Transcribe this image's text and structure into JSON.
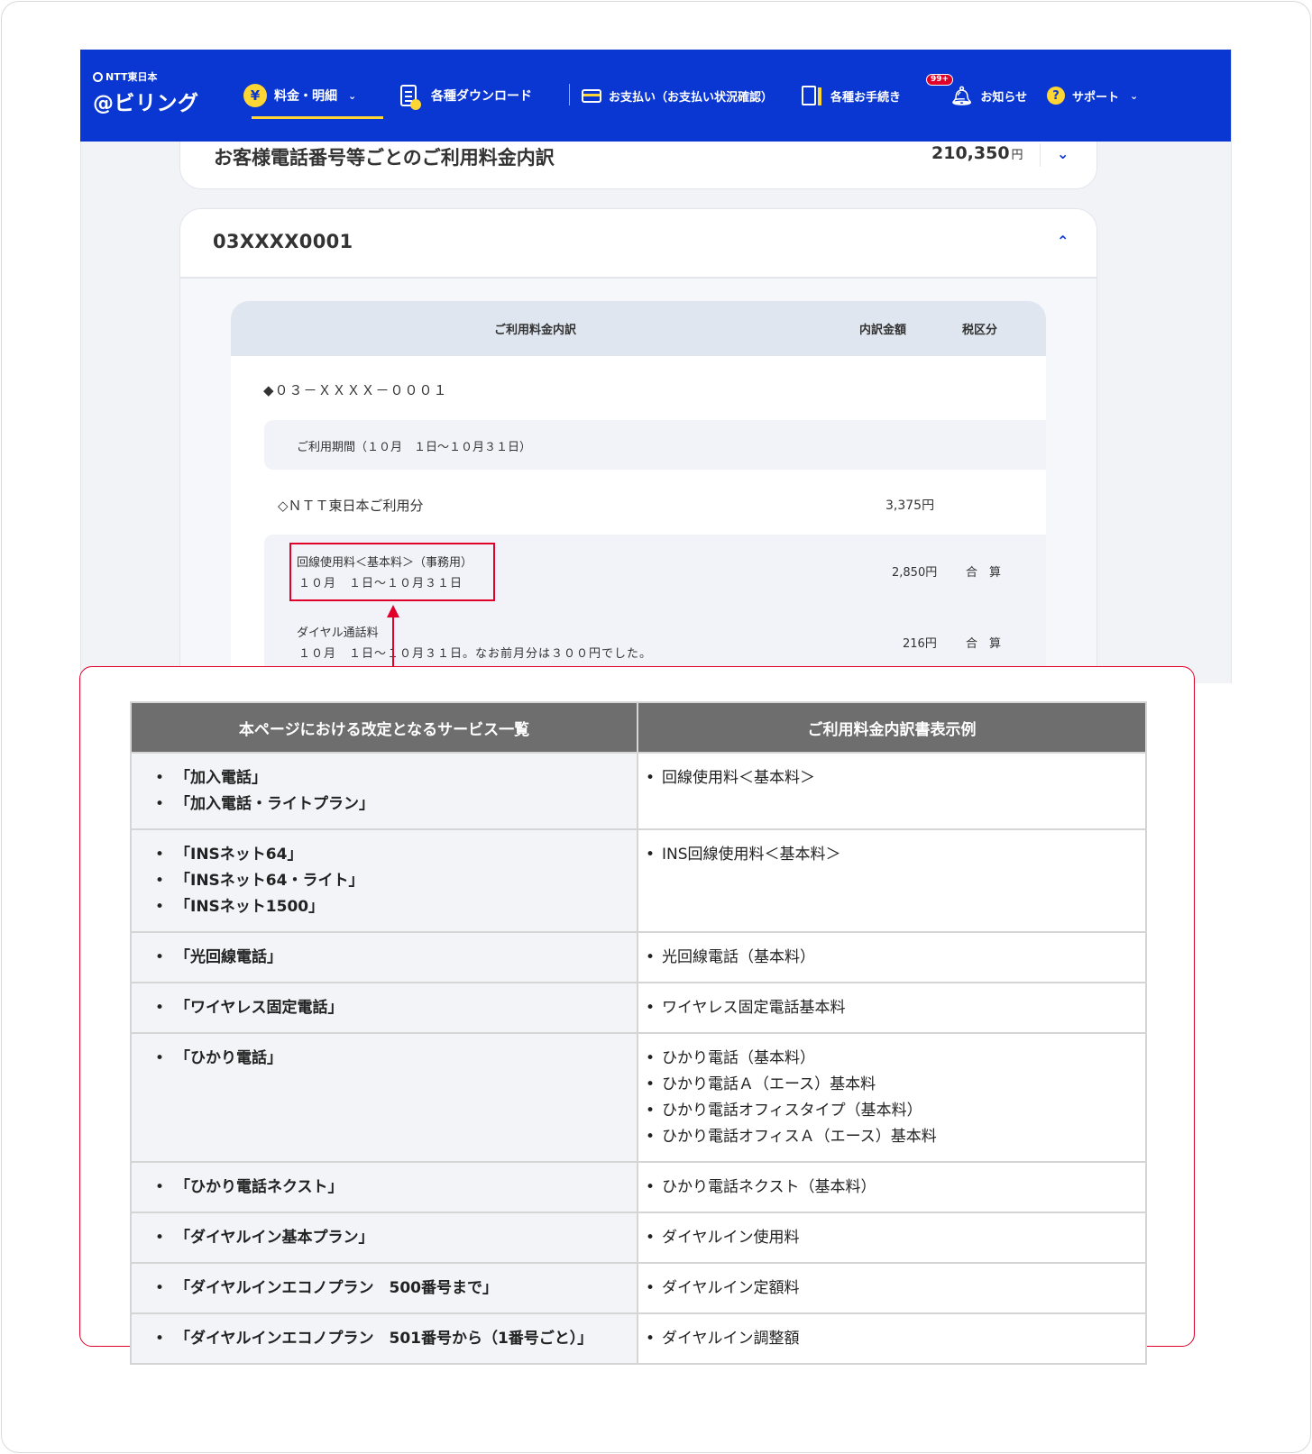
{
  "navbar": {
    "logo_small": "NTT東日本",
    "logo_main": "@ビリング",
    "items": [
      {
        "label": "料金・明細",
        "icon": "yen-icon"
      },
      {
        "label": "各種ダウンロード",
        "icon": "document-download-icon"
      },
      {
        "label": "お支払い（お支払い状況確認）",
        "icon": "credit-card-icon"
      },
      {
        "label": "各種お手続き",
        "icon": "form-icon"
      },
      {
        "label": "お知らせ",
        "icon": "bell-icon",
        "badge": "99+"
      },
      {
        "label": "サポート",
        "icon": "support-icon"
      }
    ],
    "yen_glyph": "¥",
    "support_glyph": "?",
    "colors": {
      "bar": "#0a37d2",
      "accent": "#ffd633",
      "badge": "#e0002a"
    }
  },
  "summary_card": {
    "title": "お客様電話番号等ごとのご利用料金内訳",
    "amount": "210,350",
    "unit": "円"
  },
  "number_card": {
    "title": "03XXXX0001"
  },
  "detail_table": {
    "headers": [
      "ご利用料金内訳",
      "内訳金額",
      "税区分"
    ],
    "phone_heading": "◆０３－ＸＸＸＸ－０００１",
    "period": "ご利用期間（１０月　１日～１０月３１日）",
    "section": {
      "label": "◇ＮＴＴ東日本ご利用分",
      "amount": "3,375円"
    },
    "rows": [
      {
        "line1": "回線使用料＜基本料＞（事務用）",
        "line2": "１０月　１日～１０月３１日",
        "amount": "2,850円",
        "tax": "合　算"
      },
      {
        "line1": "ダイヤル通話料",
        "line2": "１０月　１日～１０月３１日。なお前月分は３００円でした。",
        "amount": "216円",
        "tax": "合　算"
      }
    ]
  },
  "service_table": {
    "headers": [
      "本ページにおける改定となるサービス一覧",
      "ご利用料金内訳書表示例"
    ],
    "rows": [
      {
        "services": [
          "「加入電話」",
          "「加入電話・ライトプラン」"
        ],
        "examples": [
          "回線使用料＜基本料＞"
        ]
      },
      {
        "services": [
          "「INSネット64」",
          "「INSネット64・ライト」",
          "「INSネット1500」"
        ],
        "examples": [
          "INS回線使用料＜基本料＞"
        ]
      },
      {
        "services": [
          "「光回線電話」"
        ],
        "examples": [
          "光回線電話（基本料）"
        ]
      },
      {
        "services": [
          "「ワイヤレス固定電話」"
        ],
        "examples": [
          "ワイヤレス固定電話基本料"
        ]
      },
      {
        "services": [
          "「ひかり電話」"
        ],
        "examples": [
          "ひかり電話（基本料）",
          "ひかり電話Ａ（エース）基本料",
          "ひかり電話オフィスタイプ（基本料）",
          "ひかり電話オフィスＡ（エース）基本料"
        ]
      },
      {
        "services": [
          "「ひかり電話ネクスト」"
        ],
        "examples": [
          "ひかり電話ネクスト（基本料）"
        ]
      },
      {
        "services": [
          "「ダイヤルイン基本プラン」"
        ],
        "examples": [
          "ダイヤルイン使用料"
        ]
      },
      {
        "services": [
          "「ダイヤルインエコノプラン　500番号まで」"
        ],
        "examples": [
          "ダイヤルイン定額料"
        ]
      },
      {
        "services": [
          "「ダイヤルインエコノプラン　501番号から（1番号ごと）」"
        ],
        "examples": [
          "ダイヤルイン調整額"
        ]
      }
    ]
  },
  "highlight_color": "#e0002a"
}
